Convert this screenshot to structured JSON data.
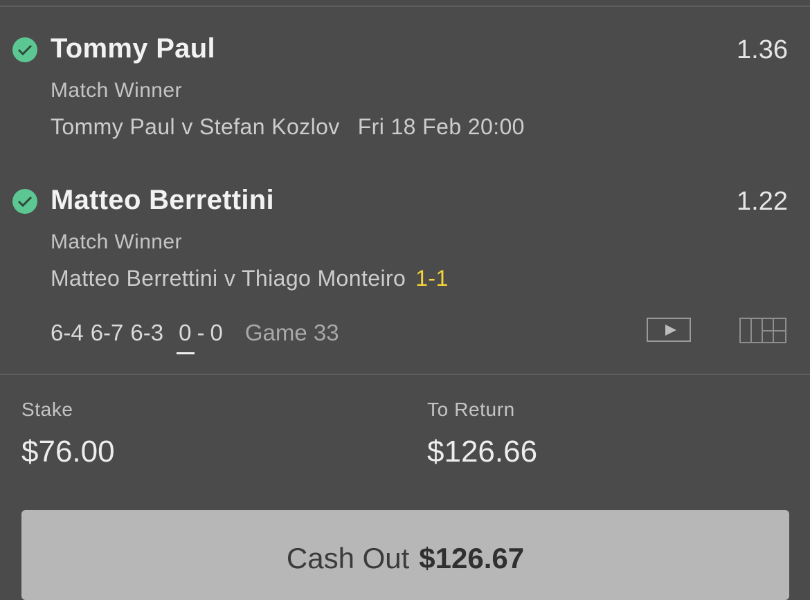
{
  "selections": [
    {
      "name": "Tommy Paul",
      "odds": "1.36",
      "market": "Match Winner",
      "event": "Tommy Paul v Stefan Kozlov",
      "datetime": "Fri 18 Feb 20:00",
      "status_icon": "check-icon",
      "status_color": "#5cc793"
    },
    {
      "name": "Matteo Berrettini",
      "odds": "1.22",
      "market": "Match Winner",
      "event": "Matteo Berrettini v Thiago Monteiro",
      "live_score": "1-1",
      "live_score_color": "#f4d63a",
      "status_icon": "check-icon",
      "status_color": "#5cc793",
      "scoreline": {
        "sets": [
          "6-4",
          "6-7",
          "6-3"
        ],
        "game_home": "0",
        "game_separator": "-",
        "game_away": "0",
        "game_label": "Game 33"
      }
    }
  ],
  "summary": {
    "stake_label": "Stake",
    "stake_value": "$76.00",
    "return_label": "To Return",
    "return_value": "$126.66"
  },
  "cashout": {
    "label": "Cash Out",
    "amount": "$126.67"
  },
  "icons": {
    "video": "play-video-icon",
    "stats": "match-stats-grid-icon"
  }
}
